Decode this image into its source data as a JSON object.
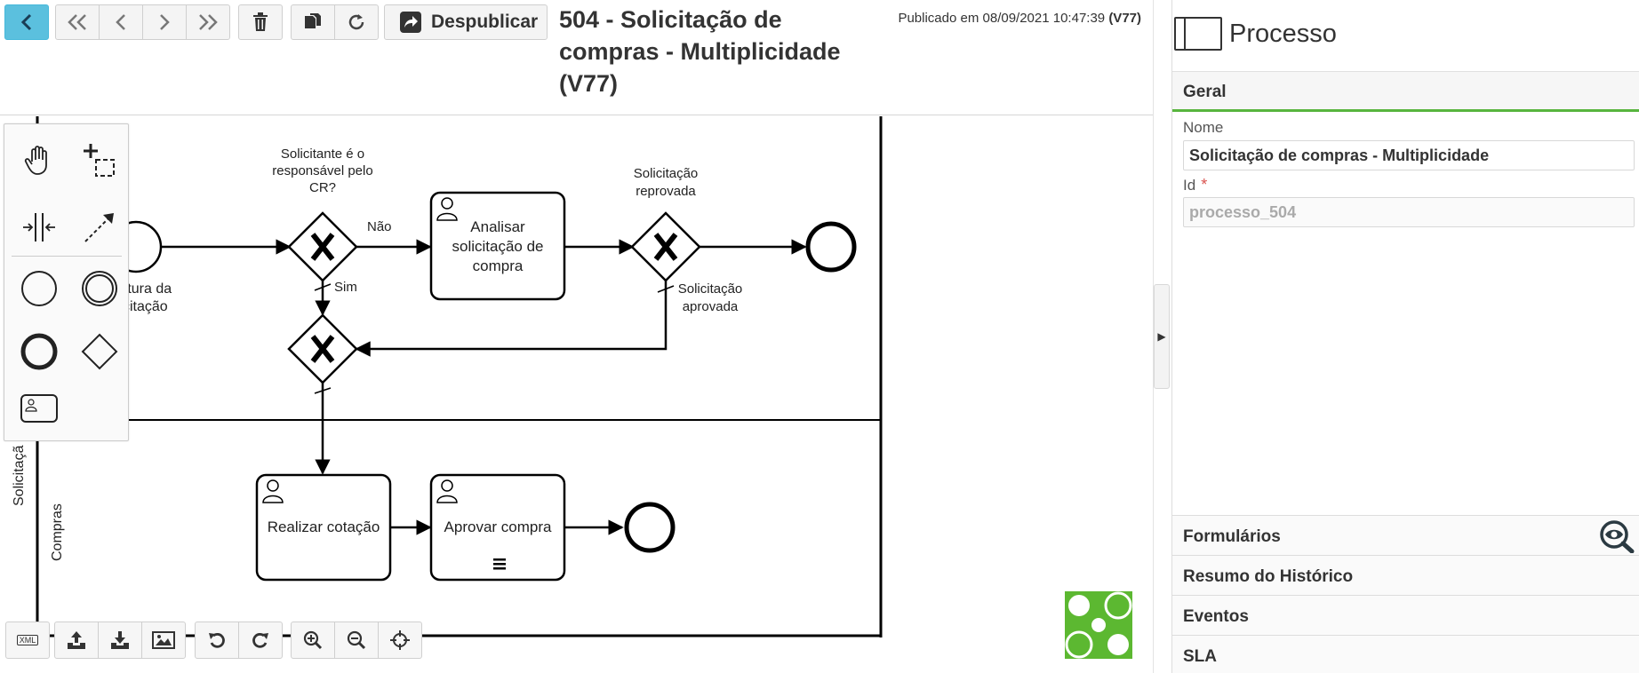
{
  "toolbar": {
    "unpublish_label": "Despublicar",
    "title": "504 - Solicitação de compras - Multiplicidade (V77)",
    "published_prefix": "Publicado em 08/09/2021 10:47:39",
    "published_version": "(V77)"
  },
  "diagram": {
    "lane_outer_label": "Solicitaçã",
    "lane_inner_label": "Compras",
    "start_label_line1": "rtura da",
    "start_label_line2": "citação",
    "gateway1_label_line1": "Solicitante é o",
    "gateway1_label_line2": "responsável pelo",
    "gateway1_label_line3": "CR?",
    "flow_nao": "Não",
    "flow_sim": "Sim",
    "task_analisar_line1": "Analisar",
    "task_analisar_line2": "solicitação de",
    "task_analisar_line3": "compra",
    "gateway2_label_line1": "Solicitação",
    "gateway2_label_line2": "reprovada",
    "flow_aprovada_line1": "Solicitação",
    "flow_aprovada_line2": "aprovada",
    "task_cotacao": "Realizar cotação",
    "task_aprovar": "Aprovar compra"
  },
  "bottom_toolbar": {
    "xml_label": "XML"
  },
  "properties": {
    "title": "Processo",
    "tab_general": "Geral",
    "name_label": "Nome",
    "name_value": "Solicitação de compras - Multiplicidade",
    "id_label": "Id",
    "id_value": "processo_504",
    "sections": [
      "Formulários",
      "Resumo do Histórico",
      "Eventos",
      "SLA"
    ]
  },
  "colors": {
    "primary_button": "#5bc0de",
    "active_tab_underline": "#58b53e",
    "logo_green": "#5cb831",
    "required_star": "#d9534f"
  }
}
